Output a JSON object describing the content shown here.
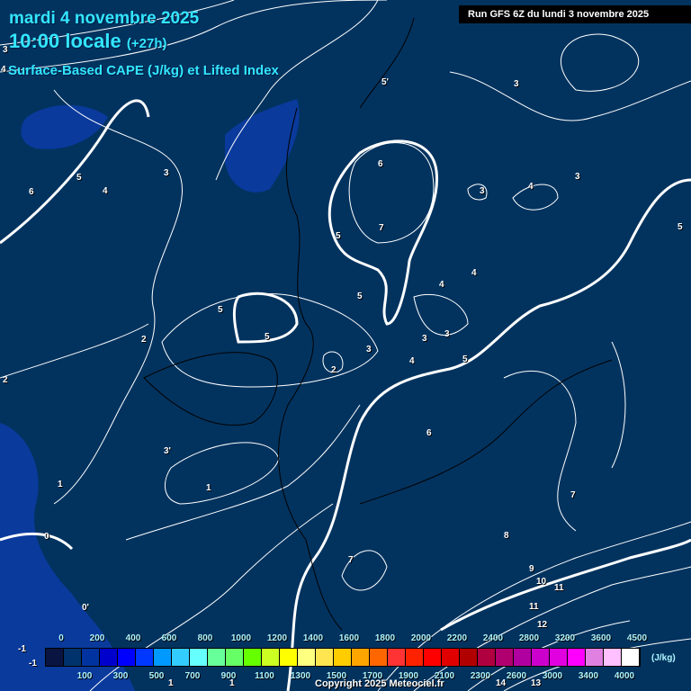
{
  "header": {
    "date": "mardi 4 novembre 2025",
    "time": "10:00 locale",
    "lead": "(+27h)",
    "parameter": "Surface-Based CAPE (J/kg) et Lifted Index",
    "run": "Run GFS 6Z du lundi 3 novembre 2025"
  },
  "contour_labels": [
    "3",
    "4",
    "5'",
    "3",
    "6",
    "3",
    "4",
    "3",
    "5",
    "4",
    "3",
    "6",
    "7",
    "5",
    "5",
    "4",
    "4",
    "5",
    "5",
    "5",
    "3",
    "3",
    "2",
    "3",
    "4",
    "5",
    "2",
    "2",
    "6",
    "3'",
    "1",
    "1",
    "7",
    "0",
    "8",
    "7",
    "9",
    "10",
    "11",
    "11",
    "0'",
    "12",
    "-1",
    "-1",
    "1",
    "1",
    "14",
    "13"
  ],
  "legend": {
    "colors": [
      "#0a1440",
      "#00336b",
      "#0033a0",
      "#0000cc",
      "#0000ff",
      "#0038ff",
      "#0099ff",
      "#33ccff",
      "#66ffff",
      "#66ff99",
      "#66ff66",
      "#66ff00",
      "#ccff22",
      "#ffff00",
      "#ffff80",
      "#ffe650",
      "#ffcc00",
      "#ffa500",
      "#ff6600",
      "#ff3333",
      "#ff2200",
      "#ff0000",
      "#e00000",
      "#b00000",
      "#b00040",
      "#b00070",
      "#b000a0",
      "#cc00cc",
      "#e000e0",
      "#ff00ff",
      "#e080e0",
      "#ffc0ff",
      "#ffffff"
    ],
    "top_labels": [
      "0",
      "200",
      "400",
      "600",
      "800",
      "1000",
      "1200",
      "1400",
      "1600",
      "1800",
      "2000",
      "2200",
      "2400",
      "2800",
      "3200",
      "3600",
      "4500"
    ],
    "bottom_labels": [
      "100",
      "300",
      "500",
      "700",
      "900",
      "1100",
      "1300",
      "1500",
      "1700",
      "1900",
      "2100",
      "2300",
      "2600",
      "3000",
      "3400",
      "4000"
    ],
    "unit": "(J/kg)"
  },
  "copyright": "Copyright 2025 Meteociel.fr"
}
